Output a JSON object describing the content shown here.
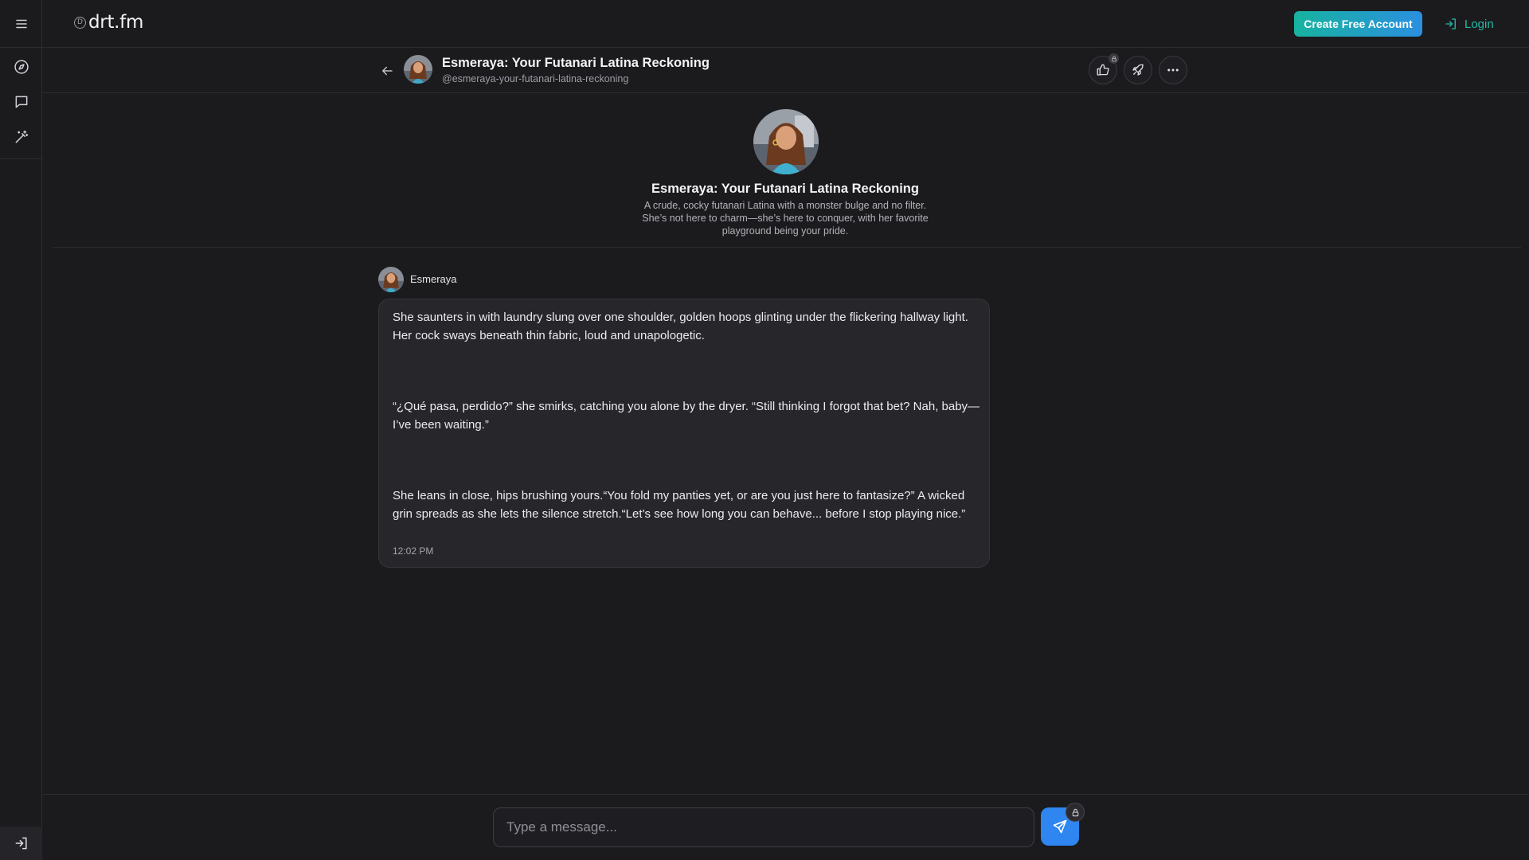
{
  "app": {
    "logo_text": "drt.fm",
    "logo_mark": "D"
  },
  "topbar": {
    "create_account_label": "Create Free Account",
    "login_label": "Login"
  },
  "rail": {
    "icons": [
      "menu-icon",
      "compass-icon",
      "chat-icon",
      "magic-wand-icon",
      "login-arrow-icon"
    ]
  },
  "character": {
    "title": "Esmeraya: Your Futanari Latina Reckoning",
    "handle": "@esmeraya-your-futanari-latina-reckoning",
    "description": "A crude, cocky futanari Latina with a monster bulge and no filter. She’s not here to charm—she’s here to conquer, with her favorite playground being your pride."
  },
  "header_actions": {
    "icons": [
      "thumbs-up-icon",
      "rocket-icon",
      "more-icon"
    ]
  },
  "message": {
    "author": "Esmeraya",
    "paragraphs": [
      "She saunters in with laundry slung over one shoulder, golden hoops glinting under the flickering hallway light. Her cock sways beneath thin fabric, loud and unapologetic.",
      "“¿Qué pasa, perdido?” she smirks, catching you alone by the dryer. “Still thinking I forgot that bet? Nah, baby—I’ve been waiting.”",
      "She leans in close, hips brushing yours.“You fold my panties yet, or are you just here to fantasize?” A wicked grin spreads as she lets the silence stretch.“Let’s see how long you can behave... before I stop playing nice.”"
    ],
    "time": "12:02 PM"
  },
  "composer": {
    "placeholder": "Type a message...",
    "value": ""
  },
  "colors": {
    "accent_teal": "#17b3a0",
    "accent_blue": "#2f86f0",
    "background": "#1b1b1e",
    "bubble": "#27272b"
  }
}
